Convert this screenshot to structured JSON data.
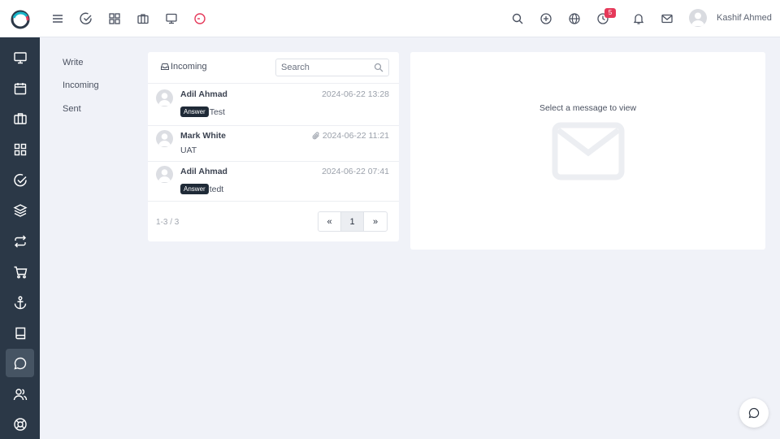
{
  "header": {
    "icons": [
      "menu-icon",
      "check-circle-icon",
      "grid-icon",
      "briefcase-icon",
      "monitor-icon",
      "clock-icon"
    ],
    "right_icons": [
      "search-icon",
      "plus-circle-icon",
      "globe-icon",
      "history-icon",
      "bell-icon",
      "mail-icon"
    ],
    "notification_count": "5",
    "user_name": "Kashif Ahmed",
    "accent_color": "#e5395a"
  },
  "sidebar": {
    "items": [
      "monitor-icon",
      "calendar-icon",
      "briefcase-icon",
      "grid-icon",
      "check-circle-icon",
      "layers-icon",
      "swap-icon",
      "cart-icon",
      "anchor-icon",
      "book-icon",
      "chat-icon",
      "users-icon",
      "lifebuoy-icon"
    ],
    "active": "chat-icon",
    "background": "#2b3847"
  },
  "subnav": {
    "items": [
      "Write",
      "Incoming",
      "Sent"
    ]
  },
  "list": {
    "title": "Incoming",
    "search_placeholder": "Search",
    "messages": [
      {
        "sender": "Adil Ahmad",
        "date": "2024-06-22 13:28",
        "tag": "Answer",
        "preview": "Test",
        "attachment": false
      },
      {
        "sender": "Mark White",
        "date": "2024-06-22 11:21",
        "tag": "",
        "preview": "UAT",
        "attachment": true
      },
      {
        "sender": "Adil Ahmad",
        "date": "2024-06-22 07:41",
        "tag": "Answer",
        "preview": "tedt",
        "attachment": false
      }
    ],
    "pagination_info": "1-3 / 3",
    "pager": {
      "prev": "«",
      "current": "1",
      "next": "»"
    }
  },
  "viewer": {
    "empty_text": "Select a message to view"
  }
}
